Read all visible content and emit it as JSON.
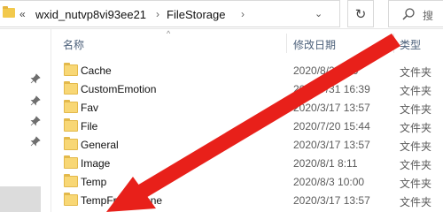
{
  "address_bar": {
    "overflow": "«",
    "crumbs": [
      "wxid_nutvp8vi93ee21",
      "FileStorage"
    ],
    "separator": "›",
    "dropdown": "⌄"
  },
  "refresh_icon": "↻",
  "search": {
    "placeholder": "搜"
  },
  "columns": {
    "name": "名称",
    "date": "修改日期",
    "type": "类型"
  },
  "sort_indicator": "^",
  "files": [
    {
      "name": "Cache",
      "date": "2020/8/2 8:40",
      "type": "文件夹"
    },
    {
      "name": "CustomEmotion",
      "date": "2020/7/31 16:39",
      "type": "文件夹"
    },
    {
      "name": "Fav",
      "date": "2020/3/17 13:57",
      "type": "文件夹"
    },
    {
      "name": "File",
      "date": "2020/7/20 15:44",
      "type": "文件夹"
    },
    {
      "name": "General",
      "date": "2020/3/17 13:57",
      "type": "文件夹"
    },
    {
      "name": "Image",
      "date": "2020/8/1 8:11",
      "type": "文件夹"
    },
    {
      "name": "Temp",
      "date": "2020/8/3 10:00",
      "type": "文件夹"
    },
    {
      "name": "TempFromPhone",
      "date": "2020/3/17 13:57",
      "type": "文件夹"
    }
  ],
  "colors": {
    "annotation_arrow": "#e8201a",
    "folder": "#f8d775",
    "header_text": "#4c607a"
  }
}
